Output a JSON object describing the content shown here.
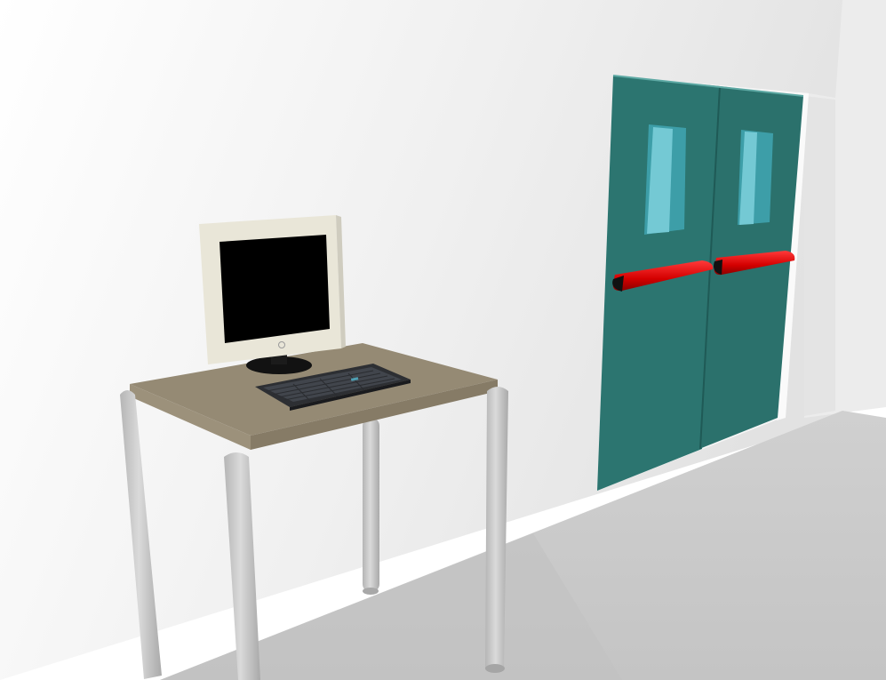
{
  "scene": {
    "objects": [
      {
        "id": "wall",
        "icon": "wall-icon"
      },
      {
        "id": "floor",
        "icon": "floor-icon"
      },
      {
        "id": "double-door",
        "icon": "door-icon"
      },
      {
        "id": "desk",
        "icon": "desk-icon"
      },
      {
        "id": "monitor",
        "icon": "monitor-icon"
      },
      {
        "id": "keyboard",
        "icon": "keyboard-icon"
      }
    ]
  },
  "colors": {
    "wall_light": "#ffffff",
    "wall_shade": "#dedede",
    "floor": "#cccccc",
    "floor_dark": "#b9b9b9",
    "door": "#2c7570",
    "door_dark": "#266a65",
    "door_window": "#6fc7d3",
    "push_bar": "#e00000",
    "desk_top": "#958a74",
    "desk_edge": "#7f7562",
    "desk_leg": "#c8c8c8",
    "monitor_bezel": "#e9e6d8",
    "monitor_screen": "#000000",
    "keyboard": "#2d2f33"
  }
}
